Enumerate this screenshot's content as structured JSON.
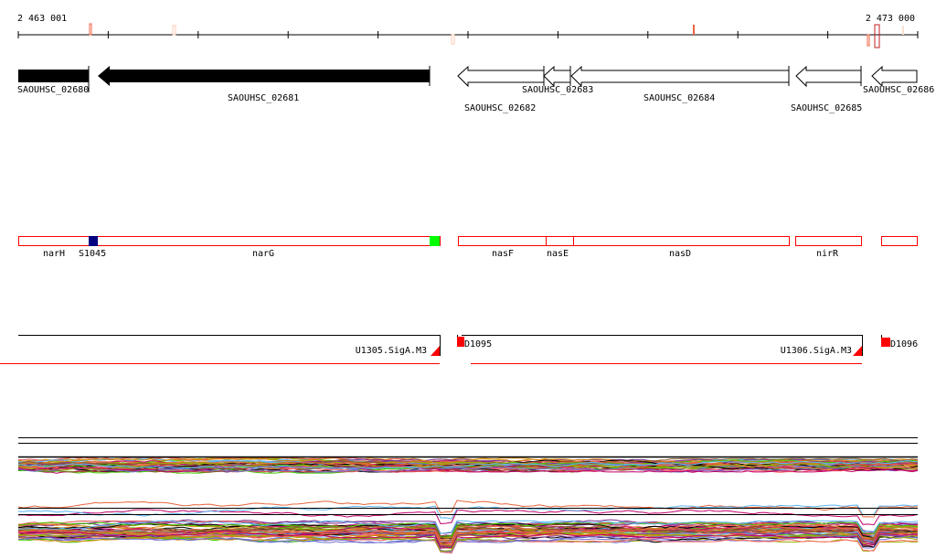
{
  "axis": {
    "start_label": "2 463 001",
    "end_label": "2 473 000"
  },
  "genes": [
    {
      "name": "SAOUHSC_02680",
      "strand": "-",
      "filled": true
    },
    {
      "name": "SAOUHSC_02681",
      "strand": "-",
      "filled": true
    },
    {
      "name": "SAOUHSC_02682",
      "strand": "-",
      "filled": false
    },
    {
      "name": "SAOUHSC_02683",
      "strand": "-",
      "filled": false
    },
    {
      "name": "SAOUHSC_02684",
      "strand": "-",
      "filled": false
    },
    {
      "name": "SAOUHSC_02685",
      "strand": "-",
      "filled": false
    },
    {
      "name": "SAOUHSC_02686",
      "strand": "-",
      "filled": false
    }
  ],
  "annotations": [
    {
      "name": "narH"
    },
    {
      "name": "S1045"
    },
    {
      "name": "narG"
    },
    {
      "name": "nasF"
    },
    {
      "name": "nasE"
    },
    {
      "name": "nasD"
    },
    {
      "name": "nirR"
    }
  ],
  "promoters": [
    {
      "name": "U1305.SigA.M3"
    },
    {
      "name": "D1095"
    },
    {
      "name": "U1306.SigA.M3"
    },
    {
      "name": "D1096"
    }
  ],
  "colors": {
    "operon": "#ff0000",
    "s1045": "#000080",
    "narG_end": "#00ff00",
    "traces": [
      "#e8663c",
      "#9aa800",
      "#c0006a",
      "#59b4f0",
      "#7a2f8f",
      "#ff6b6b",
      "#d4880a",
      "#000000",
      "#44cc00",
      "#8b5a2b",
      "#e05050",
      "#6f6fd0"
    ]
  }
}
